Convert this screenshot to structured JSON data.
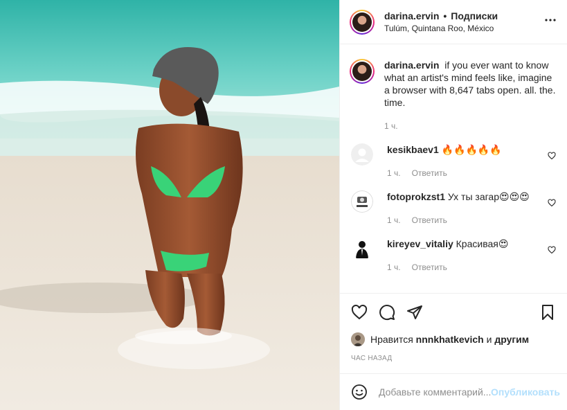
{
  "post": {
    "username": "darina.ervin",
    "separator": "•",
    "follow_label": "Подписки",
    "location": "Tulúm, Quintana Roo, México",
    "more_icon": "more-horizontal-icon"
  },
  "caption": {
    "username": "darina.ervin",
    "text": "if you ever want to know what an artist's mind feels like, imagine a browser with 8,647 tabs open. all. the. time.",
    "time": "1 ч."
  },
  "comments": [
    {
      "username": "kesikbaev1",
      "text": "🔥🔥🔥🔥🔥",
      "time": "1 ч.",
      "reply": "Ответить"
    },
    {
      "username": "fotoprokzst1",
      "text": "Ух ты загар😍😍😍",
      "time": "1 ч.",
      "reply": "Ответить"
    },
    {
      "username": "kireyev_vitaliy",
      "text": "Красивая😍",
      "time": "1 ч.",
      "reply": "Ответить"
    }
  ],
  "likes": {
    "prefix": "Нравится",
    "user": "nnnkhatkevich",
    "conjunction": "и",
    "others": "другим"
  },
  "posted_ago": "ЧАС НАЗАД",
  "add_comment": {
    "placeholder": "Добавьте комментарий...",
    "publish_label": "Опубликовать"
  },
  "colors": {
    "text": "#262626",
    "secondary": "#8e8e8e",
    "publish_disabled": "#b2dffc",
    "border": "#efefef"
  }
}
